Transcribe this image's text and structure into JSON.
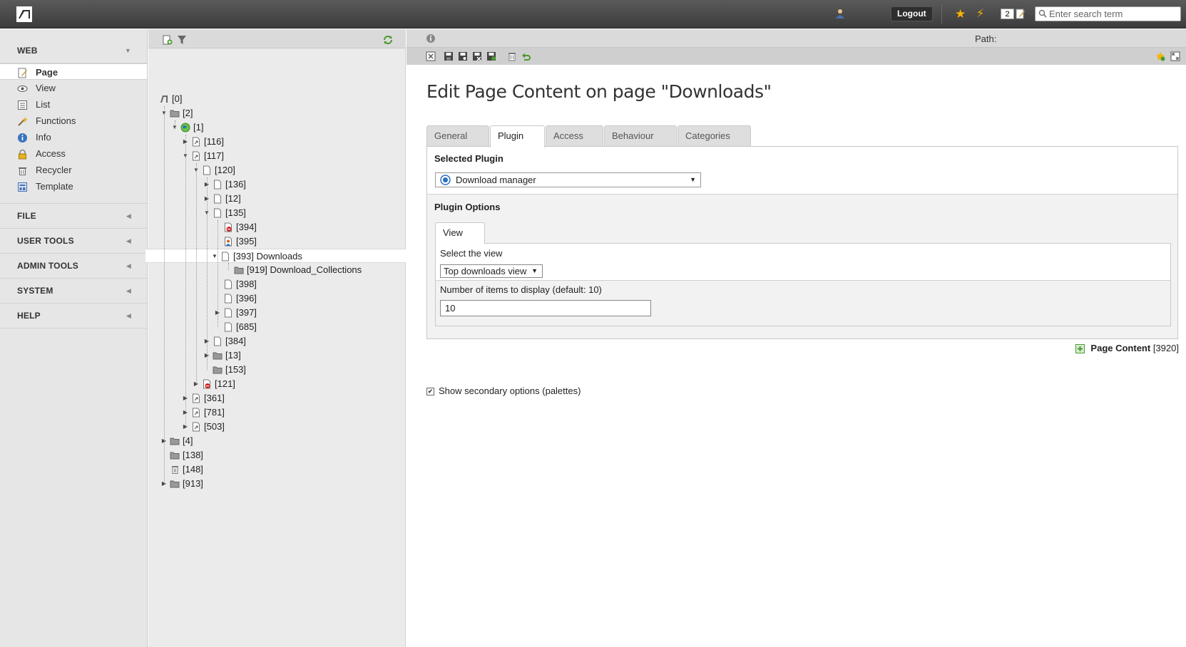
{
  "topbar": {
    "logout_label": "Logout",
    "task_count": "2",
    "search_placeholder": "Enter search term"
  },
  "modmenu": {
    "groups": [
      {
        "label": "WEB",
        "items": [
          "Page",
          "View",
          "List",
          "Functions",
          "Info",
          "Access",
          "Recycler",
          "Template"
        ]
      },
      {
        "label": "FILE"
      },
      {
        "label": "USER TOOLS"
      },
      {
        "label": "ADMIN TOOLS"
      },
      {
        "label": "SYSTEM"
      },
      {
        "label": "HELP"
      }
    ],
    "active_item": "Page"
  },
  "tree": {
    "nodes": [
      {
        "label": "[0]",
        "level": 0,
        "toggle": "",
        "icon": "root"
      },
      {
        "label": "[2]",
        "level": 1,
        "toggle": "open",
        "icon": "folder"
      },
      {
        "label": "[1]",
        "level": 2,
        "toggle": "open",
        "icon": "globe"
      },
      {
        "label": "[116]",
        "level": 3,
        "toggle": "closed",
        "icon": "page-shortcut"
      },
      {
        "label": "[117]",
        "level": 3,
        "toggle": "open",
        "icon": "page-shortcut"
      },
      {
        "label": "[120]",
        "level": 4,
        "toggle": "open",
        "icon": "page"
      },
      {
        "label": "[136]",
        "level": 5,
        "toggle": "closed",
        "icon": "page"
      },
      {
        "label": "[12]",
        "level": 5,
        "toggle": "closed",
        "icon": "page"
      },
      {
        "label": "[135]",
        "level": 5,
        "toggle": "open",
        "icon": "page"
      },
      {
        "label": "[394]",
        "level": 6,
        "toggle": "",
        "icon": "page-hidden"
      },
      {
        "label": "[395]",
        "level": 6,
        "toggle": "",
        "icon": "page-user"
      },
      {
        "label": "[393] Downloads",
        "level": 6,
        "toggle": "open",
        "icon": "page",
        "selected": true
      },
      {
        "label": "[919] Download_Collections",
        "level": 7,
        "toggle": "",
        "icon": "folder"
      },
      {
        "label": "[398]",
        "level": 6,
        "toggle": "",
        "icon": "page"
      },
      {
        "label": "[396]",
        "level": 6,
        "toggle": "",
        "icon": "page"
      },
      {
        "label": "[397]",
        "level": 6,
        "toggle": "closed",
        "icon": "page"
      },
      {
        "label": "[685]",
        "level": 6,
        "toggle": "",
        "icon": "page"
      },
      {
        "label": "[384]",
        "level": 5,
        "toggle": "closed",
        "icon": "page"
      },
      {
        "label": "[13]",
        "level": 5,
        "toggle": "closed",
        "icon": "folder"
      },
      {
        "label": "[153]",
        "level": 5,
        "toggle": "",
        "icon": "folder"
      },
      {
        "label": "[121]",
        "level": 4,
        "toggle": "closed",
        "icon": "page-hidden"
      },
      {
        "label": "[361]",
        "level": 3,
        "toggle": "closed",
        "icon": "page-shortcut"
      },
      {
        "label": "[781]",
        "level": 3,
        "toggle": "closed",
        "icon": "page-shortcut"
      },
      {
        "label": "[503]",
        "level": 3,
        "toggle": "closed",
        "icon": "page-shortcut"
      },
      {
        "label": "[4]",
        "level": 1,
        "toggle": "closed",
        "icon": "folder"
      },
      {
        "label": "[138]",
        "level": 1,
        "toggle": "",
        "icon": "folder"
      },
      {
        "label": "[148]",
        "level": 1,
        "toggle": "",
        "icon": "recycler"
      },
      {
        "label": "[913]",
        "level": 1,
        "toggle": "closed",
        "icon": "folder"
      }
    ]
  },
  "docheader": {
    "path_label": "Path:"
  },
  "content": {
    "title": "Edit Page Content on page \"Downloads\"",
    "tabs": [
      "General",
      "Plugin",
      "Access",
      "Behaviour",
      "Categories"
    ],
    "active_tab": "Plugin",
    "selected_plugin_title": "Selected Plugin",
    "plugin_value": "Download manager",
    "plugin_options_title": "Plugin Options",
    "inner_tab": "View",
    "select_view_label": "Select the view",
    "view_value": "Top downloads view",
    "num_items_label": "Number of items to display (default: 10)",
    "num_items_value": "10",
    "record_type": "Page Content",
    "record_uid": "[3920]",
    "secondary_options_label": "Show secondary options (palettes)",
    "secondary_options_checked": true
  },
  "colors": {
    "topbar": "#444444",
    "accent": "#f5b400"
  }
}
